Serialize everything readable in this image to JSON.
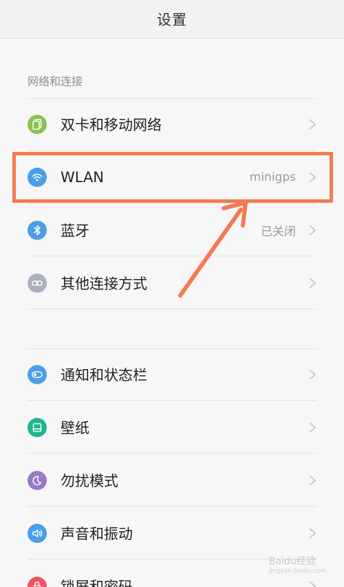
{
  "header": {
    "title": "设置"
  },
  "section_network": {
    "label": "网络和连接"
  },
  "items_network": [
    {
      "label": "双卡和移动网络",
      "value": "",
      "icon": "dual-sim-icon",
      "color": "#8cc152"
    },
    {
      "label": "WLAN",
      "value": "minigps",
      "icon": "wifi-icon",
      "color": "#4a9fe8"
    },
    {
      "label": "蓝牙",
      "value": "已关闭",
      "icon": "bluetooth-icon",
      "color": "#4a9fe8"
    },
    {
      "label": "其他连接方式",
      "value": "",
      "icon": "link-icon",
      "color": "#a9b2bd"
    }
  ],
  "items_display": [
    {
      "label": "通知和状态栏",
      "value": "",
      "icon": "notification-icon",
      "color": "#4a9fe8"
    },
    {
      "label": "壁纸",
      "value": "",
      "icon": "wallpaper-icon",
      "color": "#1fb58f"
    },
    {
      "label": "勿扰模式",
      "value": "",
      "icon": "moon-icon",
      "color": "#9a78c8"
    },
    {
      "label": "声音和振动",
      "value": "",
      "icon": "sound-icon",
      "color": "#4a9fe8"
    },
    {
      "label": "锁屏和密码",
      "value": "",
      "icon": "lock-icon",
      "color": "#ed5565"
    }
  ],
  "annotation": {
    "highlight_color": "#f47a50"
  },
  "watermark": {
    "text": "Baidu经验",
    "url": "jingyan.baidu.com"
  }
}
